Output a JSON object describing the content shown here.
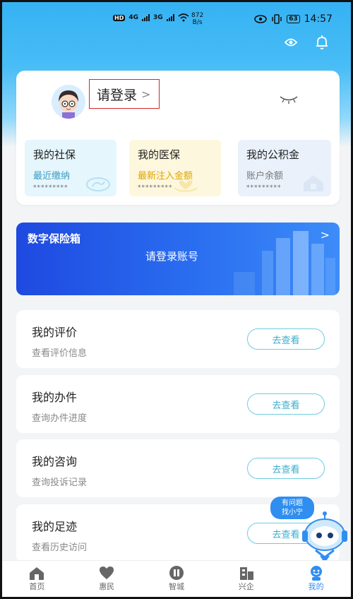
{
  "status_bar": {
    "network": "HD",
    "sim1": "4G",
    "sim2": "3G",
    "speed_value": "872",
    "speed_unit": "B/s",
    "battery": "63",
    "time": "14:57"
  },
  "user_card": {
    "login_label": "请登录",
    "login_chevron": ">",
    "tiles": [
      {
        "title": "我的社保",
        "subtitle": "最近缴纳",
        "masked": "*********"
      },
      {
        "title": "我的医保",
        "subtitle": "最新注入金额",
        "masked": "*********"
      },
      {
        "title": "我的公积金",
        "subtitle": "账户余额",
        "masked": "*********"
      }
    ]
  },
  "banner": {
    "title": "数字保险箱",
    "subtitle": "请登录账号",
    "chevron": ">"
  },
  "list_items": [
    {
      "title": "我的评价",
      "subtitle": "查看评价信息",
      "button": "去查看"
    },
    {
      "title": "我的办件",
      "subtitle": "查询办件进度",
      "button": "去查看"
    },
    {
      "title": "我的咨询",
      "subtitle": "查询投诉记录",
      "button": "去查看"
    },
    {
      "title": "我的足迹",
      "subtitle": "查看历史访问",
      "button": "去查看"
    }
  ],
  "assistant": {
    "bubble_line1": "有问题",
    "bubble_line2": "找小宁"
  },
  "tabbar": [
    {
      "label": "首页",
      "icon": "home-icon"
    },
    {
      "label": "惠民",
      "icon": "heart-icon"
    },
    {
      "label": "智城",
      "icon": "city-icon"
    },
    {
      "label": "兴企",
      "icon": "building-icon"
    },
    {
      "label": "我的",
      "icon": "profile-icon",
      "active": true
    }
  ],
  "colors": {
    "header_blue": "#35b2f3",
    "accent_blue": "#2f8ef0",
    "button_border": "#6ccde0",
    "highlight_red": "#d62727"
  }
}
